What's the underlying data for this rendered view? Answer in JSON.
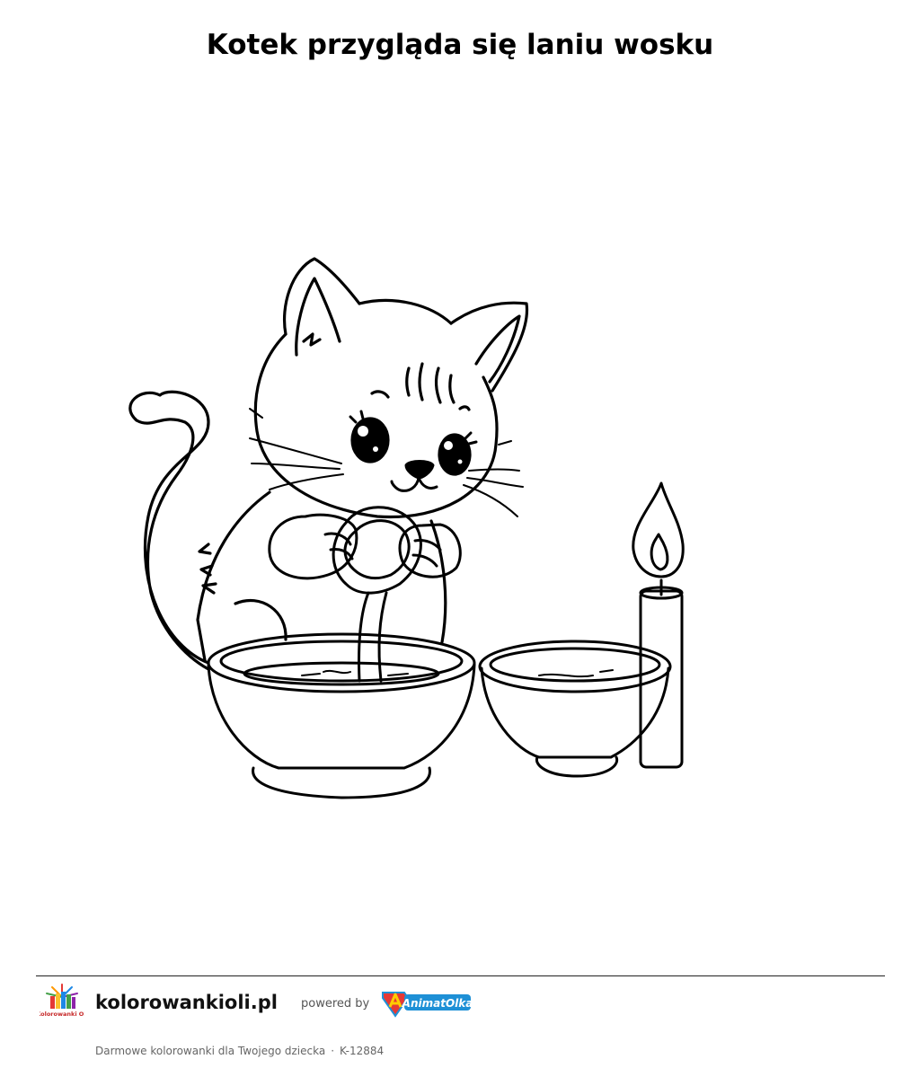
{
  "page": {
    "title": "Kotek przygląda się laniu wosku"
  },
  "illustration": {
    "subject_icon": "cat-pouring-wax-coloring-page"
  },
  "footer": {
    "site_name": "kolorowankioli.pl",
    "powered_by": "powered by",
    "partner_name": "AnimatOlka",
    "tagline": "Darmowe kolorowanki dla Twojego dziecka",
    "separator": "·",
    "page_code": "K-12884",
    "logo_text": "Kolorowanki Oli"
  },
  "colors": {
    "ink": "#000000",
    "partner_blue": "#1e90d6",
    "partner_red": "#e53935",
    "partner_yellow": "#ffcc00"
  }
}
